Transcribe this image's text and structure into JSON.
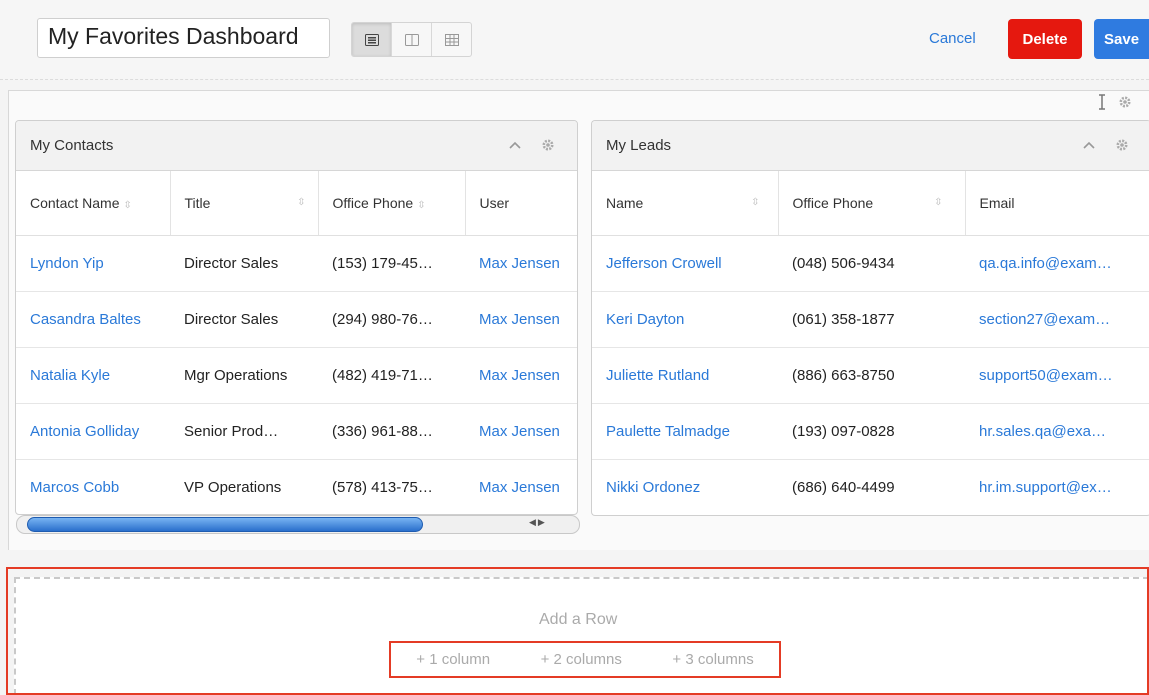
{
  "header": {
    "title": "My Favorites Dashboard",
    "layout_buttons": [
      {
        "icon": "rows-layout-icon",
        "active": true
      },
      {
        "icon": "two-column-layout-icon",
        "active": false
      },
      {
        "icon": "grid-layout-icon",
        "active": false
      }
    ],
    "cancel_label": "Cancel",
    "delete_label": "Delete",
    "save_label": "Save"
  },
  "contacts": {
    "title": "My Contacts",
    "columns": [
      "Contact Name",
      "Title",
      "Office Phone",
      "User"
    ],
    "rows": [
      [
        "Lyndon Yip",
        "Director Sales",
        "(153) 179-45…",
        "Max Jensen"
      ],
      [
        "Casandra Baltes",
        "Director Sales",
        "(294) 980-76…",
        "Max Jensen"
      ],
      [
        "Natalia Kyle",
        "Mgr Operations",
        "(482) 419-71…",
        "Max Jensen"
      ],
      [
        "Antonia Golliday",
        "Senior Prod…",
        "(336) 961-88…",
        "Max Jensen"
      ],
      [
        "Marcos Cobb",
        "VP Operations",
        "(578) 413-75…",
        "Max Jensen"
      ]
    ]
  },
  "leads": {
    "title": "My Leads",
    "columns": [
      "Name",
      "Office Phone",
      "Email"
    ],
    "rows": [
      [
        "Jefferson Crowell",
        "(048) 506-9434",
        "qa.qa.info@exam…"
      ],
      [
        "Keri Dayton",
        "(061) 358-1877",
        "section27@exam…"
      ],
      [
        "Juliette Rutland",
        "(886) 663-8750",
        "support50@exam…"
      ],
      [
        "Paulette Talmadge",
        "(193) 097-0828",
        "hr.sales.qa@exa…"
      ],
      [
        "Nikki Ordonez",
        "(686) 640-4499",
        "hr.im.support@ex…"
      ]
    ]
  },
  "add_row": {
    "label": "Add a Row",
    "options": [
      "+ 1 column",
      "+ 2 columns",
      "+ 3 columns"
    ]
  },
  "colors": {
    "link": "#2a79d8",
    "delete": "#e5180f",
    "save": "#2f7be0",
    "highlight": "#e43b25"
  }
}
